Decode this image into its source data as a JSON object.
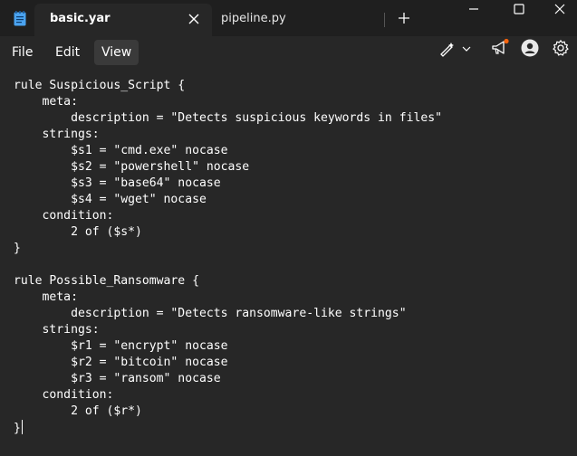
{
  "tabs": [
    {
      "label": "basic.yar",
      "active": true
    },
    {
      "label": "pipeline.py",
      "active": false
    }
  ],
  "menu": {
    "file": "File",
    "edit": "Edit",
    "view": "View"
  },
  "editor": {
    "lines": [
      "rule Suspicious_Script {",
      "    meta:",
      "        description = \"Detects suspicious keywords in files\"",
      "    strings:",
      "        $s1 = \"cmd.exe\" nocase",
      "        $s2 = \"powershell\" nocase",
      "        $s3 = \"base64\" nocase",
      "        $s4 = \"wget\" nocase",
      "    condition:",
      "        2 of ($s*)",
      "}",
      "",
      "rule Possible_Ransomware {",
      "    meta:",
      "        description = \"Detects ransomware-like strings\"",
      "    strings:",
      "        $r1 = \"encrypt\" nocase",
      "        $r2 = \"bitcoin\" nocase",
      "        $r3 = \"ransom\" nocase",
      "    condition:",
      "        2 of ($r*)",
      "}"
    ]
  },
  "colors": {
    "titlebar_bg": "#1f1f1f",
    "editor_bg": "#272727",
    "text": "#ffffff",
    "app_icon": "#4aa3f0",
    "notification_dot": "#f7630c"
  },
  "icons": {
    "app": "notepad-icon",
    "close_tab": "close-icon",
    "new_tab": "plus-icon",
    "minimize": "minimize-icon",
    "maximize": "maximize-icon",
    "close_window": "close-icon",
    "copilot": "copilot-pen-icon",
    "whats_new": "megaphone-icon",
    "account": "avatar-icon",
    "settings": "gear-icon"
  }
}
